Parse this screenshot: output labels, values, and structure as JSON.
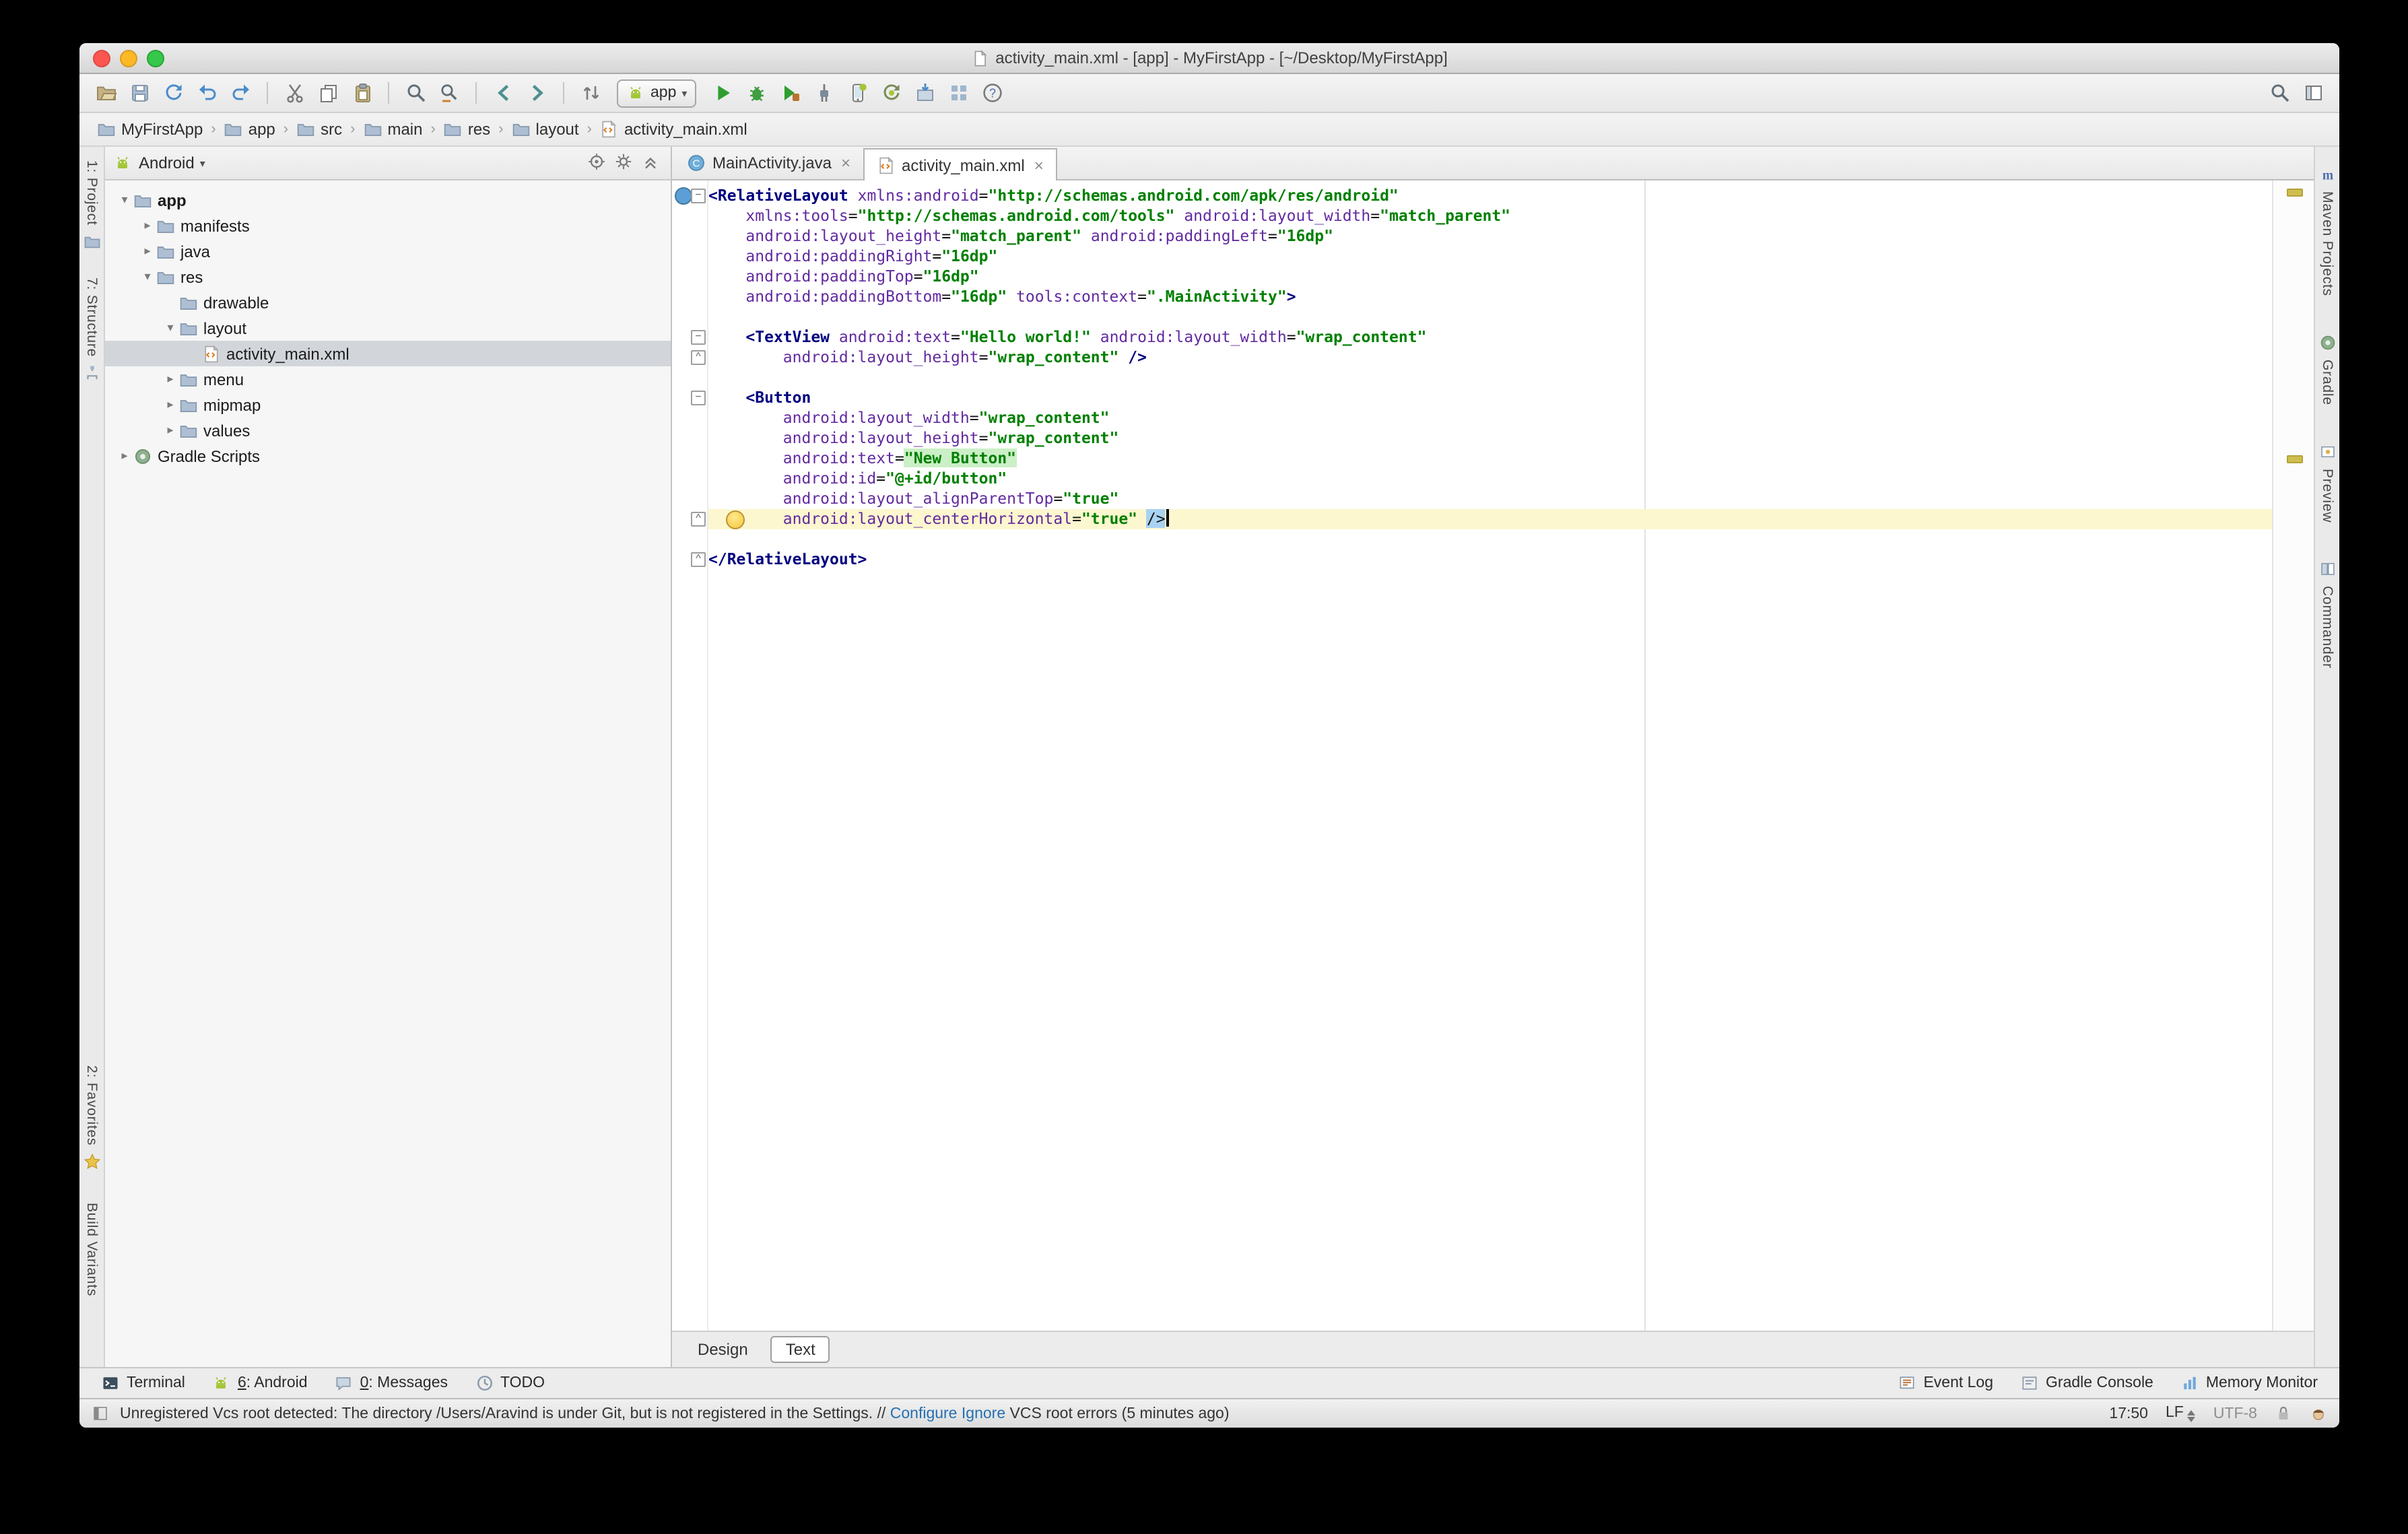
{
  "window": {
    "title": "activity_main.xml - [app] - MyFirstApp - [~/Desktop/MyFirstApp]"
  },
  "toolbar": {
    "run_config": "app",
    "left_icons": [
      "open-project-icon",
      "save-all-icon",
      "synchronize-icon",
      "undo-icon",
      "redo-icon",
      "divider",
      "cut-icon",
      "copy-icon",
      "paste-icon",
      "divider",
      "find-icon",
      "replace-icon",
      "divider",
      "back-icon",
      "forward-icon",
      "divider",
      "compare-icon"
    ],
    "run_icons": [
      "run-icon",
      "debug-icon",
      "run-coverage-icon",
      "attach-debugger-icon",
      "avd-manager-icon",
      "sync-gradle-icon",
      "sdk-manager-icon",
      "project-structure-icon",
      "help-icon"
    ],
    "right_icons": [
      "search-everywhere-icon",
      "toolwindow-layout-icon"
    ]
  },
  "breadcrumbs": [
    {
      "label": "MyFirstApp",
      "icon": "folder"
    },
    {
      "label": "app",
      "icon": "folder"
    },
    {
      "label": "src",
      "icon": "folder"
    },
    {
      "label": "main",
      "icon": "folder"
    },
    {
      "label": "res",
      "icon": "folder"
    },
    {
      "label": "layout",
      "icon": "folder"
    },
    {
      "label": "activity_main.xml",
      "icon": "xml"
    }
  ],
  "left_stripe": {
    "top": [
      {
        "label": "1: Project",
        "icon": "project-icon"
      },
      {
        "label": "7: Structure",
        "icon": "structure-icon"
      }
    ],
    "bottom": [
      {
        "label": "2: Favorites",
        "icon": "favorites-icon"
      },
      {
        "label": "Build Variants",
        "icon": ""
      }
    ]
  },
  "right_stripe": [
    {
      "label": "Maven Projects",
      "icon": "maven-icon"
    },
    {
      "label": "Gradle",
      "icon": "gradle-icon"
    },
    {
      "label": "Preview",
      "icon": "preview-icon"
    },
    {
      "label": "Commander",
      "icon": "commander-icon"
    }
  ],
  "project_panel": {
    "view": "Android",
    "header_icons": [
      "locate-icon",
      "gear-icon",
      "collapse-all-icon"
    ],
    "tree": [
      {
        "label": "app",
        "indent": 0,
        "arrow": "open",
        "icon": "folder",
        "bold": true
      },
      {
        "label": "manifests",
        "indent": 1,
        "arrow": "closed",
        "icon": "folder"
      },
      {
        "label": "java",
        "indent": 1,
        "arrow": "closed",
        "icon": "folder"
      },
      {
        "label": "res",
        "indent": 1,
        "arrow": "open",
        "icon": "folder"
      },
      {
        "label": "drawable",
        "indent": 2,
        "arrow": "none",
        "icon": "folder"
      },
      {
        "label": "layout",
        "indent": 2,
        "arrow": "open",
        "icon": "folder"
      },
      {
        "label": "activity_main.xml",
        "indent": 3,
        "arrow": "none",
        "icon": "xml",
        "selected": true
      },
      {
        "label": "menu",
        "indent": 2,
        "arrow": "closed",
        "icon": "folder"
      },
      {
        "label": "mipmap",
        "indent": 2,
        "arrow": "closed",
        "icon": "folder"
      },
      {
        "label": "values",
        "indent": 2,
        "arrow": "closed",
        "icon": "folder"
      },
      {
        "label": "Gradle Scripts",
        "indent": 0,
        "arrow": "closed",
        "icon": "gradle"
      }
    ]
  },
  "editor": {
    "tabs": [
      {
        "label": "MainActivity.java",
        "icon": "class",
        "active": false
      },
      {
        "label": "activity_main.xml",
        "icon": "xml",
        "active": true
      }
    ],
    "bottom_tabs": [
      {
        "label": "Design",
        "active": false
      },
      {
        "label": "Text",
        "active": true
      }
    ],
    "gutter_markers": [
      {
        "line": 1,
        "type": "component"
      },
      {
        "line": 1,
        "type": "fold-open"
      },
      {
        "line": 8,
        "type": "fold-open"
      },
      {
        "line": 9,
        "type": "fold-end"
      },
      {
        "line": 11,
        "type": "fold-open"
      },
      {
        "line": 17,
        "type": "fold-end"
      },
      {
        "line": 19,
        "type": "fold-end"
      }
    ],
    "error_marks": [
      6,
      204
    ],
    "code": [
      {
        "tk": [
          [
            "t",
            "<RelativeLayout"
          ],
          [
            "p",
            " "
          ],
          [
            "a",
            "xmlns:android"
          ],
          [
            "p",
            "="
          ],
          [
            "v",
            "\"http://schemas.android.com/apk/res/android\""
          ]
        ]
      },
      {
        "tk": [
          [
            "p",
            "    "
          ],
          [
            "a",
            "xmlns:tools"
          ],
          [
            "p",
            "="
          ],
          [
            "v",
            "\"http://schemas.android.com/tools\""
          ],
          [
            "p",
            " "
          ],
          [
            "a",
            "android:layout_width"
          ],
          [
            "p",
            "="
          ],
          [
            "v",
            "\"match_parent\""
          ]
        ]
      },
      {
        "tk": [
          [
            "p",
            "    "
          ],
          [
            "a",
            "android:layout_height"
          ],
          [
            "p",
            "="
          ],
          [
            "v",
            "\"match_parent\""
          ],
          [
            "p",
            " "
          ],
          [
            "a",
            "android:paddingLeft"
          ],
          [
            "p",
            "="
          ],
          [
            "v",
            "\"16dp\""
          ]
        ]
      },
      {
        "tk": [
          [
            "p",
            "    "
          ],
          [
            "a",
            "android:paddingRight"
          ],
          [
            "p",
            "="
          ],
          [
            "v",
            "\"16dp\""
          ]
        ]
      },
      {
        "tk": [
          [
            "p",
            "    "
          ],
          [
            "a",
            "android:paddingTop"
          ],
          [
            "p",
            "="
          ],
          [
            "v",
            "\"16dp\""
          ]
        ]
      },
      {
        "tk": [
          [
            "p",
            "    "
          ],
          [
            "a",
            "android:paddingBottom"
          ],
          [
            "p",
            "="
          ],
          [
            "v",
            "\"16dp\""
          ],
          [
            "p",
            " "
          ],
          [
            "a",
            "tools:context"
          ],
          [
            "p",
            "="
          ],
          [
            "v",
            "\".MainActivity\""
          ],
          [
            "t",
            ">"
          ]
        ]
      },
      {
        "tk": []
      },
      {
        "tk": [
          [
            "p",
            "    "
          ],
          [
            "t",
            "<TextView"
          ],
          [
            "p",
            " "
          ],
          [
            "a",
            "android:text"
          ],
          [
            "p",
            "="
          ],
          [
            "v",
            "\"Hello world!\""
          ],
          [
            "p",
            " "
          ],
          [
            "a",
            "android:layout_width"
          ],
          [
            "p",
            "="
          ],
          [
            "v",
            "\"wrap_content\""
          ]
        ]
      },
      {
        "tk": [
          [
            "p",
            "        "
          ],
          [
            "a",
            "android:layout_height"
          ],
          [
            "p",
            "="
          ],
          [
            "v",
            "\"wrap_content\""
          ],
          [
            "p",
            " "
          ],
          [
            "t",
            "/>"
          ]
        ]
      },
      {
        "tk": []
      },
      {
        "tk": [
          [
            "p",
            "    "
          ],
          [
            "t",
            "<Button"
          ]
        ]
      },
      {
        "tk": [
          [
            "p",
            "        "
          ],
          [
            "a",
            "android:layout_width"
          ],
          [
            "p",
            "="
          ],
          [
            "v",
            "\"wrap_content\""
          ]
        ]
      },
      {
        "tk": [
          [
            "p",
            "        "
          ],
          [
            "a",
            "android:layout_height"
          ],
          [
            "p",
            "="
          ],
          [
            "v",
            "\"wrap_content\""
          ]
        ]
      },
      {
        "tk": [
          [
            "p",
            "        "
          ],
          [
            "a",
            "android:text"
          ],
          [
            "p",
            "="
          ],
          [
            "h",
            "\"New Button\""
          ]
        ]
      },
      {
        "tk": [
          [
            "p",
            "        "
          ],
          [
            "a",
            "android:id"
          ],
          [
            "p",
            "="
          ],
          [
            "v",
            "\"@+id/button\""
          ]
        ]
      },
      {
        "tk": [
          [
            "p",
            "        "
          ],
          [
            "a",
            "android:layout_alignParentTop"
          ],
          [
            "p",
            "="
          ],
          [
            "v",
            "\"true\""
          ]
        ]
      },
      {
        "tk": [
          [
            "p",
            "        "
          ],
          [
            "a",
            "android:layout_centerHorizontal"
          ],
          [
            "p",
            "="
          ],
          [
            "v",
            "\"true\""
          ],
          [
            "p",
            " "
          ],
          [
            "m",
            "/>"
          ]
        ],
        "caret": true,
        "bulb": true
      },
      {
        "tk": []
      },
      {
        "tk": [
          [
            "t",
            "</RelativeLayout>"
          ]
        ]
      }
    ]
  },
  "bottom_bar": {
    "left": [
      {
        "label": "Terminal",
        "icon": "terminal-icon",
        "mnemonic": false
      },
      {
        "label": "6: Android",
        "icon": "android-icon",
        "mnemonic": true
      },
      {
        "label": "0: Messages",
        "icon": "messages-icon",
        "mnemonic": true
      },
      {
        "label": "TODO",
        "icon": "todo-icon",
        "mnemonic": false
      }
    ],
    "right": [
      {
        "label": "Event Log",
        "icon": "event-log-icon",
        "mnemonic": false
      },
      {
        "label": "Gradle Console",
        "icon": "gradle-console-icon",
        "mnemonic": false
      },
      {
        "label": "Memory Monitor",
        "icon": "memory-monitor-icon",
        "mnemonic": false
      }
    ]
  },
  "status_bar": {
    "message_prefix": "Unregistered Vcs root detected: The directory /Users/Aravind is under Git, but is not registered in the Settings. //",
    "link_configure": "Configure",
    "link_ignore": "Ignore",
    "message_suffix": "VCS root errors (5 minutes ago)",
    "time": "17:50",
    "line_ending": "LF",
    "encoding": "UTF-8"
  }
}
